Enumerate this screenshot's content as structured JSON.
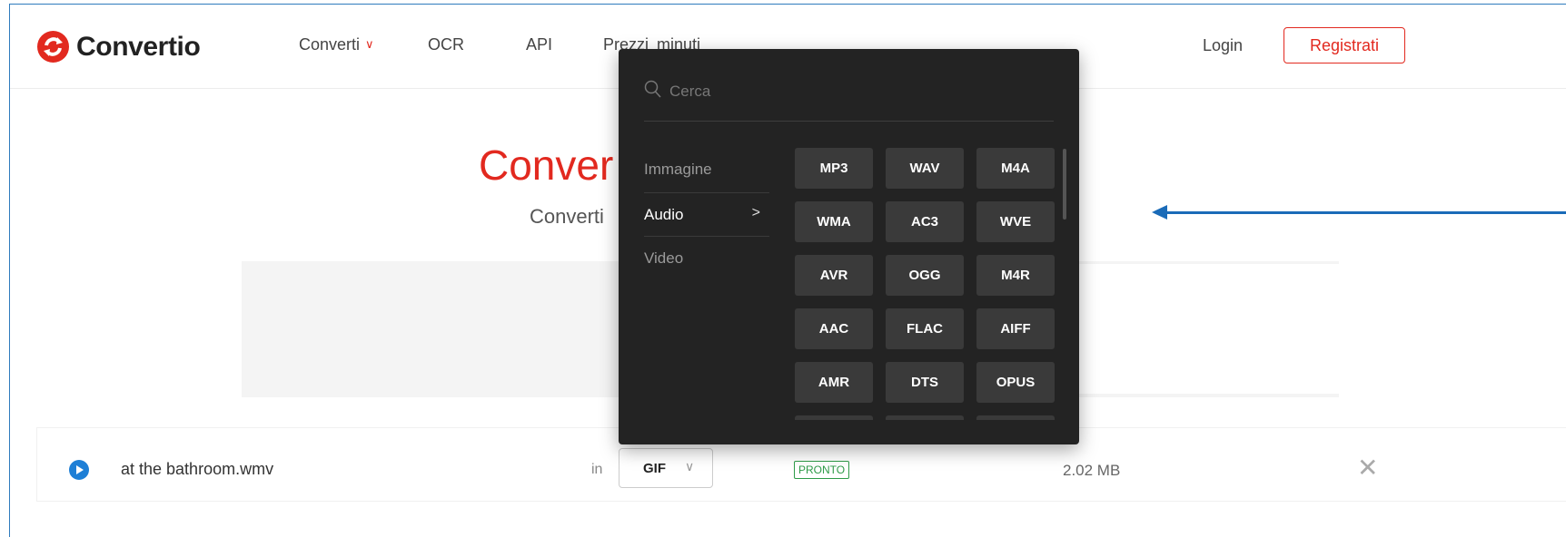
{
  "header": {
    "logo_text": "Convertio",
    "nav": [
      {
        "label": "Converti",
        "has_dropdown": true
      },
      {
        "label": "OCR"
      },
      {
        "label": "API"
      },
      {
        "label": "Prezzi"
      },
      {
        "label": "minuti"
      }
    ],
    "login_label": "Login",
    "register_label": "Registrati"
  },
  "hero": {
    "title_visible": "Conver",
    "subtitle_visible": "Converti"
  },
  "file": {
    "name": "at the bathroom.wmv",
    "in_label": "in",
    "target_format": "GIF",
    "status": "PRONTO",
    "size": "2.02 MB"
  },
  "dropdown": {
    "search_placeholder": "Cerca",
    "categories": [
      {
        "label": "Immagine",
        "active": false
      },
      {
        "label": "Audio",
        "active": true
      },
      {
        "label": "Video",
        "active": false
      }
    ],
    "active_caret": ">",
    "formats": [
      "MP3",
      "WAV",
      "M4A",
      "WMA",
      "AC3",
      "WVE",
      "AVR",
      "OGG",
      "M4R",
      "AAC",
      "FLAC",
      "AIFF",
      "AMR",
      "DTS",
      "OPUS"
    ]
  },
  "colors": {
    "brand_red": "#e2291f",
    "dropdown_bg": "#232323",
    "format_btn_bg": "#3a3a3a",
    "status_green": "#2e9b48",
    "annotation_arrow": "#1a6bb8"
  },
  "icons": [
    "logo-icon",
    "chevron-down-icon",
    "search-icon",
    "chevron-right-icon",
    "play-icon",
    "close-icon",
    "arrow-annotation"
  ]
}
